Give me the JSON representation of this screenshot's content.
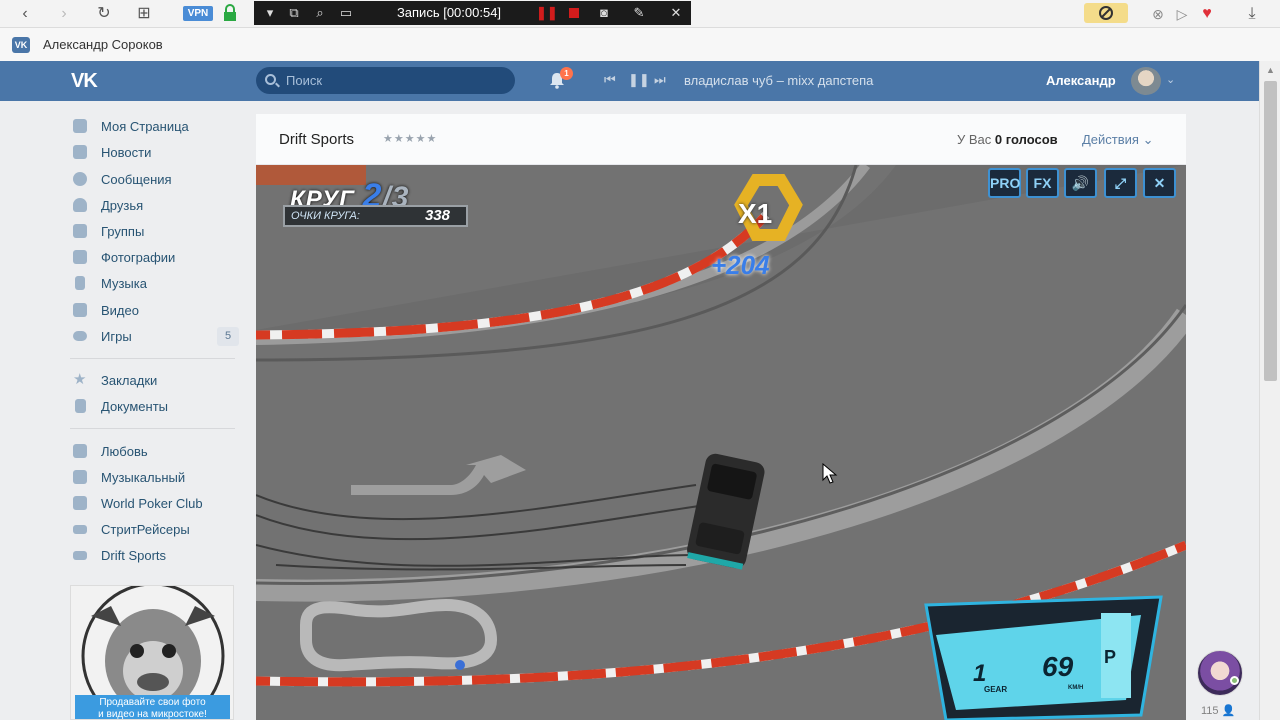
{
  "browser": {
    "vpn_label": "VPN",
    "recording_text": "Запись [00:00:54]"
  },
  "bookmark": {
    "vk_icon": "VK",
    "name": "Александр Сороков"
  },
  "header": {
    "logo": "VK",
    "search_placeholder": "Поиск",
    "notifications_count": "1",
    "track": "владислав чуб – mixx дапстепа",
    "user_name": "Александр"
  },
  "menu": {
    "items": [
      {
        "label": "Моя Страница",
        "icon": "home-icon"
      },
      {
        "label": "Новости",
        "icon": "news-icon"
      },
      {
        "label": "Сообщения",
        "icon": "messages-icon"
      },
      {
        "label": "Друзья",
        "icon": "friends-icon"
      },
      {
        "label": "Группы",
        "icon": "groups-icon"
      },
      {
        "label": "Фотографии",
        "icon": "camera-icon"
      },
      {
        "label": "Музыка",
        "icon": "music-icon"
      },
      {
        "label": "Видео",
        "icon": "video-icon"
      },
      {
        "label": "Игры",
        "icon": "games-icon",
        "counter": "5"
      }
    ],
    "items2": [
      {
        "label": "Закладки",
        "icon": "star-icon"
      },
      {
        "label": "Документы",
        "icon": "document-icon"
      }
    ],
    "apps": [
      {
        "label": "Любовь",
        "icon": "app-grid-icon"
      },
      {
        "label": "Музыкальный",
        "icon": "app-grid-icon"
      },
      {
        "label": "World Poker Club",
        "icon": "app-grid-icon"
      },
      {
        "label": "СтритРейсеры",
        "icon": "car-icon"
      },
      {
        "label": "Drift Sports",
        "icon": "car-icon"
      }
    ]
  },
  "ad": {
    "text_line1": "Продавайте свои фото",
    "text_line2": "и видео на микростоке!"
  },
  "game": {
    "title": "Drift Sports",
    "stars": "★★★★★",
    "votes_prefix": "У Вас",
    "votes_count": "0 голосов",
    "actions": "Действия",
    "hud": {
      "lap_label": "КРУГ",
      "lap_current": "2",
      "lap_total": "3",
      "points_label": "ОЧКИ КРУГА:",
      "points_value": "338",
      "multiplier": "X1",
      "bonus": "+204",
      "buttons": [
        "PRO",
        "FX",
        "🔊",
        "⤢",
        "✕"
      ],
      "gear": "1",
      "gear_label": "GEAR",
      "speed": "69",
      "speed_unit": "KM/H",
      "park": "P"
    }
  },
  "chat": {
    "count": "115"
  }
}
